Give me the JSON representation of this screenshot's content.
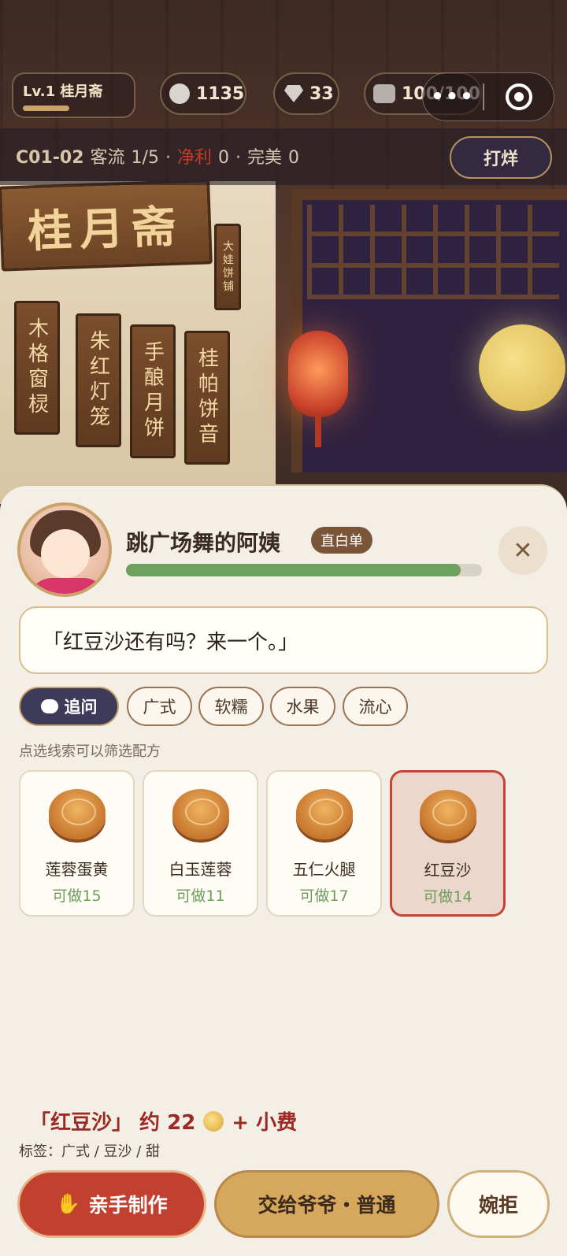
{
  "hud": {
    "level": "Lv.1 桂月斋",
    "level_progress": 0.45,
    "coins": "1135",
    "gems": "33",
    "stamina": "100/100",
    "more_icon": "more-dots-icon",
    "target_icon": "target-icon"
  },
  "status": {
    "code": "C01-02",
    "customers_label": "客流",
    "customers_value": "1/5",
    "dot": "·",
    "profit_label": "净利",
    "profit_value": "0",
    "perfect_label": "完美",
    "perfect_value": "0",
    "close_shop": "打烊"
  },
  "scene": {
    "signboard": "桂月斋",
    "plaques": [
      "木格窗棂",
      "朱红灯笼",
      "手酿月饼",
      "桂帕饼音"
    ],
    "small_plaque": "大娃饼铺"
  },
  "customer": {
    "name": "跳广场舞的阿姨",
    "tag": "直白单",
    "patience": 0.94,
    "dialogue": "「红豆沙还有吗？来一个。」"
  },
  "chips": {
    "ask": "追问",
    "items": [
      "广式",
      "软糯",
      "水果",
      "流心"
    ]
  },
  "hint": "点选线索可以筛选配方",
  "recipes": [
    {
      "name": "莲蓉蛋黄",
      "count": "可做15"
    },
    {
      "name": "白玉莲蓉",
      "count": "可做11"
    },
    {
      "name": "五仁火腿",
      "count": "可做17"
    },
    {
      "name": "红豆沙",
      "count": "可做14"
    }
  ],
  "order": {
    "price_text": "「红豆沙」 约 22",
    "tip": "+ 小费",
    "tags": "标签：广式 / 豆沙 / 甜"
  },
  "actions": {
    "make": "亲手制作",
    "grandpa": "交给爷爷・普通",
    "refuse": "婉拒"
  },
  "colors": {
    "accent_red": "#c1402f",
    "patience_green": "#6ea15e",
    "gold": "#d6a85e",
    "navy": "#3e3a5a"
  }
}
